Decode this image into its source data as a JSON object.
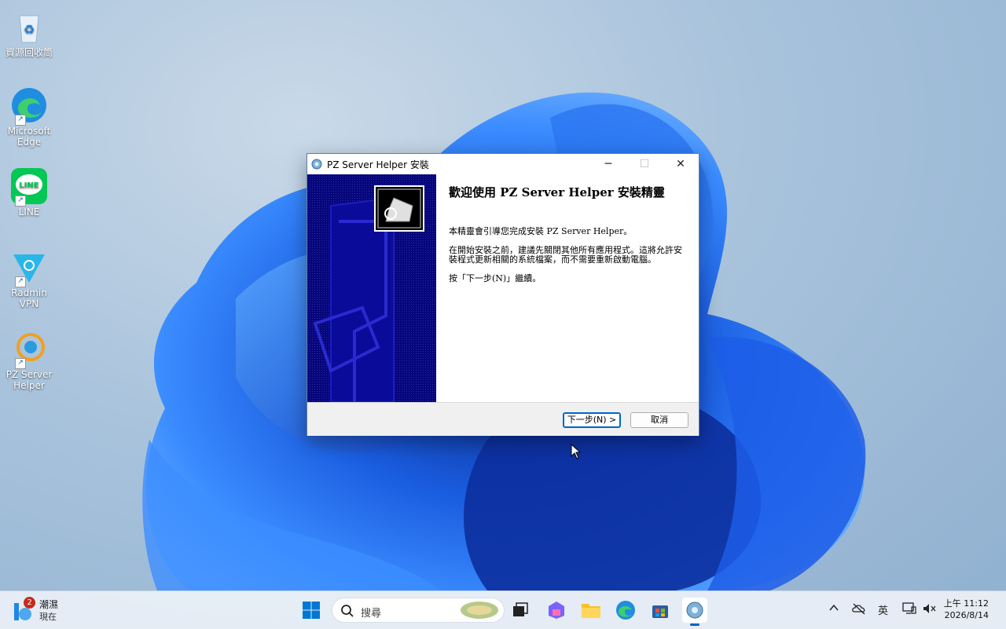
{
  "desktop": {
    "icons": [
      {
        "label": "資源回收筒",
        "glyph": "♻"
      },
      {
        "label": "Microsoft Edge",
        "glyph": "e"
      },
      {
        "label": "LINE",
        "glyph": "LINE"
      },
      {
        "label": "Radmin VPN",
        "glyph": "▼"
      },
      {
        "label": "PZ Server Helper",
        "glyph": "◎"
      }
    ],
    "shortcut_glyph": "↗"
  },
  "dialog": {
    "title": "PZ Server Helper 安裝",
    "minimize": "─",
    "maximize": "☐",
    "close": "✕",
    "heading": "歡迎使用 PZ Server Helper 安裝精靈",
    "para1": "本精靈會引導您完成安裝 PZ Server Helper。",
    "para2": "在開始安裝之前，建議先關閉其他所有應用程式。這將允許安裝程式更新相關的系統檔案，而不需要重新啟動電腦。",
    "para3": "按「下一步(N)」繼續。",
    "next_label": "下一步(N) >",
    "cancel_label": "取消"
  },
  "taskbar": {
    "weather_badge": "2",
    "weather_temp": "潮濕",
    "weather_sub": "現在",
    "search_placeholder": "搜尋",
    "tray_ime": "英",
    "clock_time": "上午 11:12",
    "clock_date": "2026/8/14",
    "colors": {
      "accent": "#0067c0",
      "badge": "#c42b1c"
    }
  }
}
